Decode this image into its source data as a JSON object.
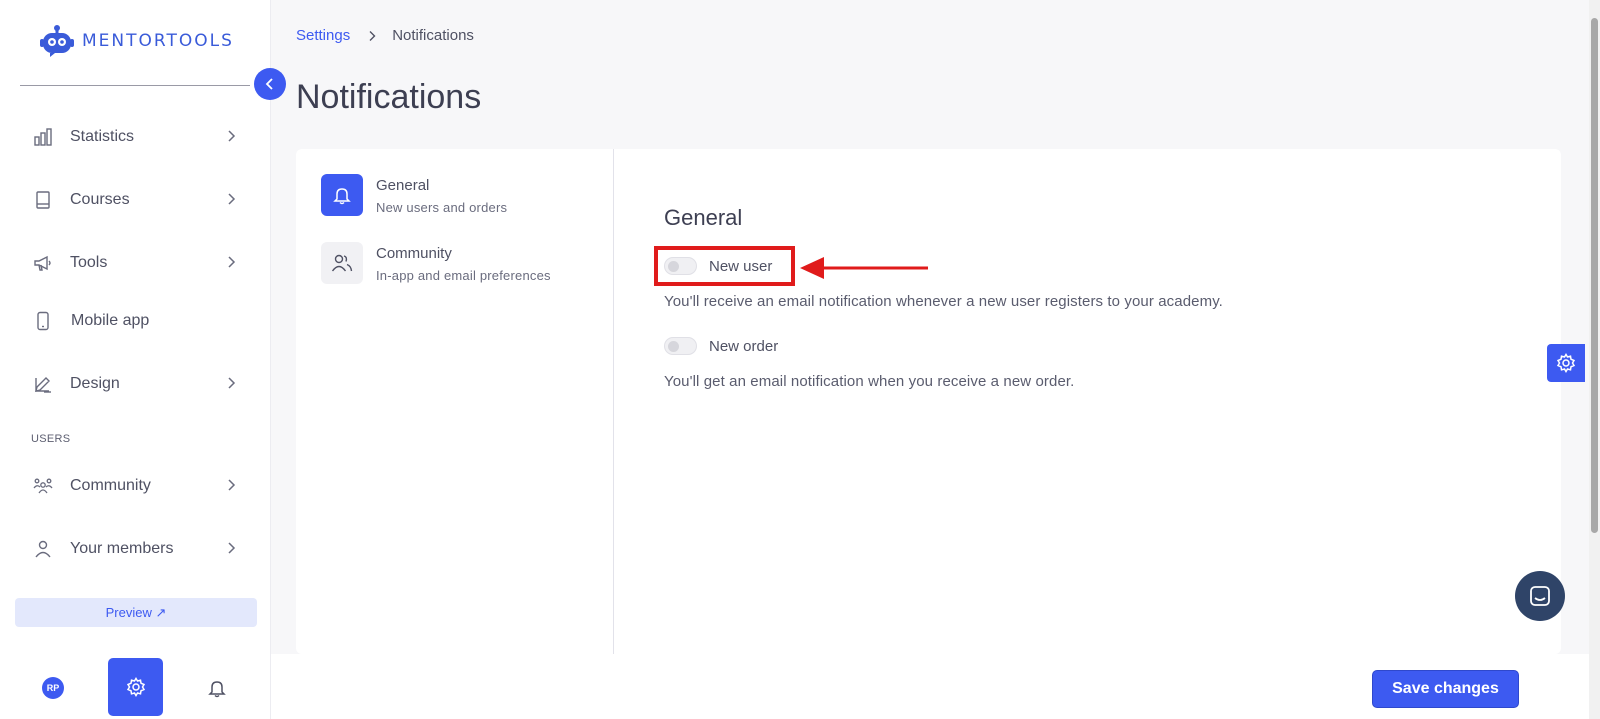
{
  "app": {
    "brand": "MENTORTOOLS"
  },
  "sidebar": {
    "items": [
      {
        "label": "Statistics",
        "icon": "bar-chart-icon",
        "has_chevron": true
      },
      {
        "label": "Courses",
        "icon": "book-icon",
        "has_chevron": true
      },
      {
        "label": "Tools",
        "icon": "megaphone-icon",
        "has_chevron": true
      },
      {
        "label": "Mobile app",
        "icon": "phone-icon",
        "has_chevron": false
      },
      {
        "label": "Design",
        "icon": "pencil-icon",
        "has_chevron": true
      }
    ],
    "users_section_label": "USERS",
    "users_items": [
      {
        "label": "Community",
        "icon": "people-group-icon",
        "has_chevron": true
      },
      {
        "label": "Your members",
        "icon": "user-icon",
        "has_chevron": true
      }
    ],
    "preview_label": "Preview ↗",
    "avatar_initials": "RP"
  },
  "breadcrumb": {
    "parent": "Settings",
    "current": "Notifications"
  },
  "page": {
    "title": "Notifications"
  },
  "settings_menu": [
    {
      "title": "General",
      "subtitle": "New users and orders",
      "active": true,
      "icon": "bell-icon"
    },
    {
      "title": "Community",
      "subtitle": "In-app and email preferences",
      "active": false,
      "icon": "users-icon"
    }
  ],
  "general": {
    "section_title": "General",
    "toggles": [
      {
        "label": "New user",
        "enabled": false,
        "description": "You'll receive an email notification whenever a new user registers to your academy."
      },
      {
        "label": "New order",
        "enabled": false,
        "description": "You'll get an email notification when you receive a new order."
      }
    ]
  },
  "footer": {
    "save_label": "Save changes"
  },
  "colors": {
    "accent": "#3d5af1",
    "annotation": "#e01b1b",
    "chat": "#2f4468"
  }
}
